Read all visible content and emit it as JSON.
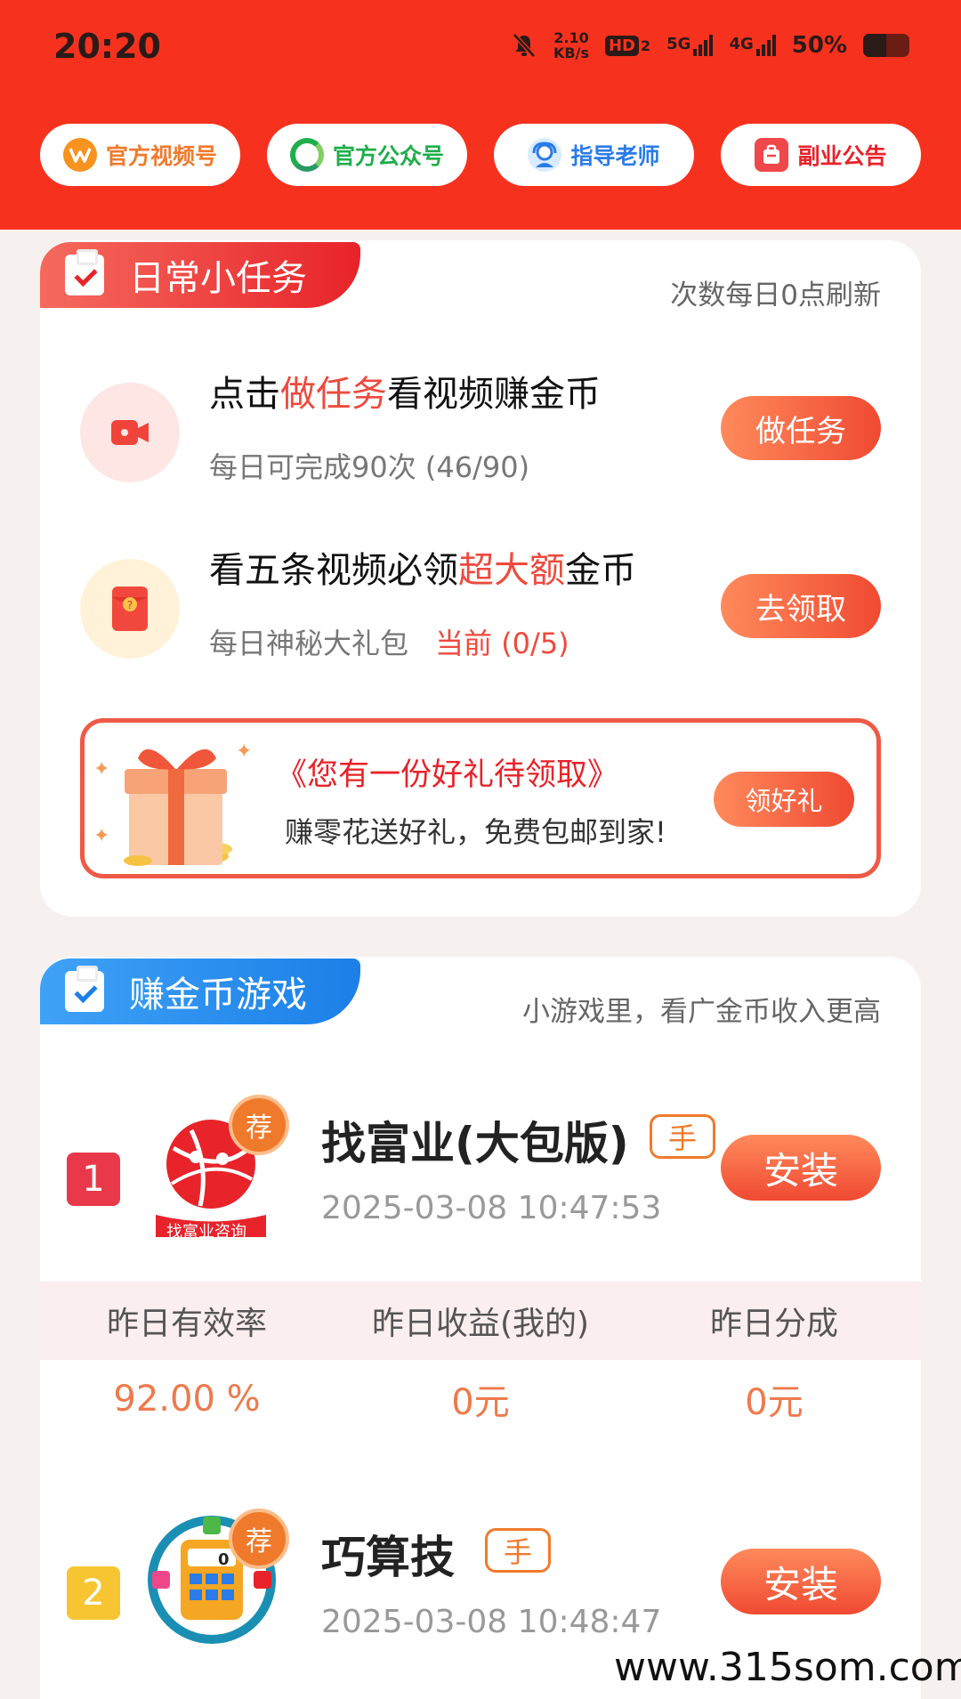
{
  "status_bar": {
    "time": "20:20",
    "speed_value": "2.10",
    "speed_unit": "KB/s",
    "hd_label": "HD",
    "hd_sub": "2",
    "net1": "5G",
    "net2": "4G",
    "battery_text": "50%",
    "battery_level": 0.5
  },
  "top_buttons": [
    {
      "label": "官方视频号",
      "icon": "channels-icon",
      "color": "#f07a2c"
    },
    {
      "label": "官方公众号",
      "icon": "wechat-official-icon",
      "color": "#1fae4a"
    },
    {
      "label": "指导老师",
      "icon": "teacher-icon",
      "color": "#2a7be8"
    },
    {
      "label": "副业公告",
      "icon": "notice-bag-icon",
      "color": "#e8232a"
    }
  ],
  "daily": {
    "tag_title": "日常小任务",
    "note": "次数每日0点刷新",
    "task1": {
      "title_pre": "点击",
      "title_hl": "做任务",
      "title_post": "看视频赚金币",
      "sub": "每日可完成90次 (46/90)",
      "button": "做任务",
      "icon": "video-camera-icon"
    },
    "task2": {
      "title_pre": "看五条视频必领",
      "title_hl": "超大额",
      "title_post": "金币",
      "sub_pre": "每日神秘大礼包",
      "sub_hl": "当前 (0/5)",
      "button": "去领取",
      "icon": "red-envelope-icon"
    },
    "gift": {
      "title": "《您有一份好礼待领取》",
      "subtitle": "赚零花送好礼，免费包邮到家!",
      "button": "领好礼",
      "icon": "gift-box-icon"
    }
  },
  "games": {
    "tag_title": "赚金币游戏",
    "note": "小游戏里，看广金币收入更高",
    "items": [
      {
        "rank": "1",
        "rank_color": "#e8384a",
        "name": "找富业(大包版)",
        "badge": "荐",
        "tag": "手",
        "date": "2025-03-08 10:47:53",
        "button": "安装",
        "logo_caption": "找富业咨询"
      },
      {
        "rank": "2",
        "rank_color": "#f7c531",
        "name": "巧算技",
        "badge": "荐",
        "tag": "手",
        "date": "2025-03-08 10:48:47",
        "button": "安装",
        "logo_digit": "0"
      }
    ],
    "stats": {
      "headers": [
        "昨日有效率",
        "昨日收益(我的)",
        "昨日分成"
      ],
      "values": [
        "92.00 %",
        "0元",
        "0元"
      ]
    }
  },
  "watermark": "www.315som.com"
}
